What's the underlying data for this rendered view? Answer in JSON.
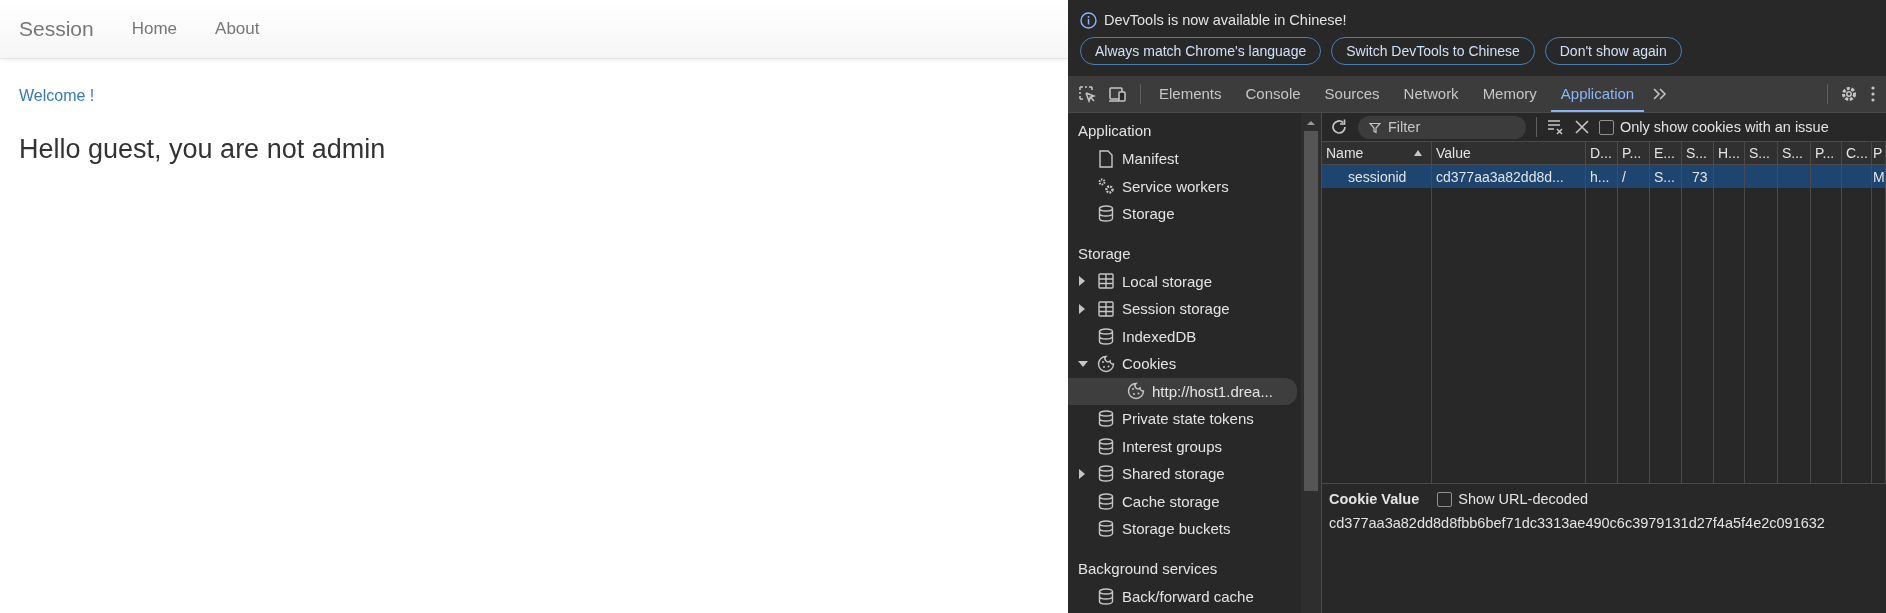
{
  "page": {
    "brand": "Session",
    "nav": [
      {
        "label": "Home"
      },
      {
        "label": "About"
      }
    ],
    "welcome": "Welcome !",
    "heading": "Hello guest, you are not admin"
  },
  "devtools": {
    "infobar": {
      "message": "DevTools is now available in Chinese!",
      "buttons": [
        "Always match Chrome's language",
        "Switch DevTools to Chinese",
        "Don't show again"
      ]
    },
    "tabs": [
      {
        "label": "Elements",
        "selected": false
      },
      {
        "label": "Console",
        "selected": false
      },
      {
        "label": "Sources",
        "selected": false
      },
      {
        "label": "Network",
        "selected": false
      },
      {
        "label": "Memory",
        "selected": false
      },
      {
        "label": "Application",
        "selected": true
      }
    ],
    "sidebar": [
      {
        "title": "Application",
        "items": [
          {
            "label": "Manifest",
            "kind": "document",
            "selected": false
          },
          {
            "label": "Service workers",
            "kind": "workers",
            "selected": false
          },
          {
            "label": "Storage",
            "kind": "store",
            "selected": false
          }
        ]
      },
      {
        "title": "Storage",
        "items": [
          {
            "label": "Local storage",
            "kind": "grid",
            "expanded": false,
            "selected": false
          },
          {
            "label": "Session storage",
            "kind": "grid",
            "expanded": false,
            "selected": false
          },
          {
            "label": "IndexedDB",
            "kind": "store",
            "selected": false
          },
          {
            "label": "Cookies",
            "kind": "cookie",
            "expanded": true,
            "selected": false,
            "children": [
              {
                "label": "http://host1.drea...",
                "kind": "cookie",
                "selected": true
              }
            ]
          },
          {
            "label": "Private state tokens",
            "kind": "store",
            "selected": false
          },
          {
            "label": "Interest groups",
            "kind": "store",
            "selected": false
          },
          {
            "label": "Shared storage",
            "kind": "store",
            "expanded": false,
            "selected": false
          },
          {
            "label": "Cache storage",
            "kind": "store",
            "selected": false
          },
          {
            "label": "Storage buckets",
            "kind": "store",
            "selected": false
          }
        ]
      },
      {
        "title": "Background services",
        "items": [
          {
            "label": "Back/forward cache",
            "kind": "store",
            "selected": false
          }
        ]
      }
    ],
    "filter": {
      "placeholder": "Filter"
    },
    "issue_filter": {
      "label": "Only show cookies with an issue",
      "checked": false
    },
    "table": {
      "columns": [
        {
          "label": "Name",
          "sorted": true
        },
        {
          "label": "Value"
        },
        {
          "label": "D..."
        },
        {
          "label": "P..."
        },
        {
          "label": "E..."
        },
        {
          "label": "S..."
        },
        {
          "label": "H..."
        },
        {
          "label": "S..."
        },
        {
          "label": "S..."
        },
        {
          "label": "P..."
        },
        {
          "label": "C..."
        },
        {
          "label": "P"
        }
      ],
      "rows": [
        {
          "selected": true,
          "cells": [
            "sessionid",
            "cd377aa3a82dd8d...",
            "h...",
            "/",
            "S...",
            "73",
            null,
            null,
            null,
            null,
            null,
            "M"
          ]
        }
      ]
    },
    "cookie_value": {
      "title": "Cookie Value",
      "decode": {
        "label": "Show URL-decoded",
        "checked": false
      },
      "value": "cd377aa3a82dd8d8fbb6bef71dc3313ae490c6c3979131d27f4a5f4e2c091632"
    }
  }
}
